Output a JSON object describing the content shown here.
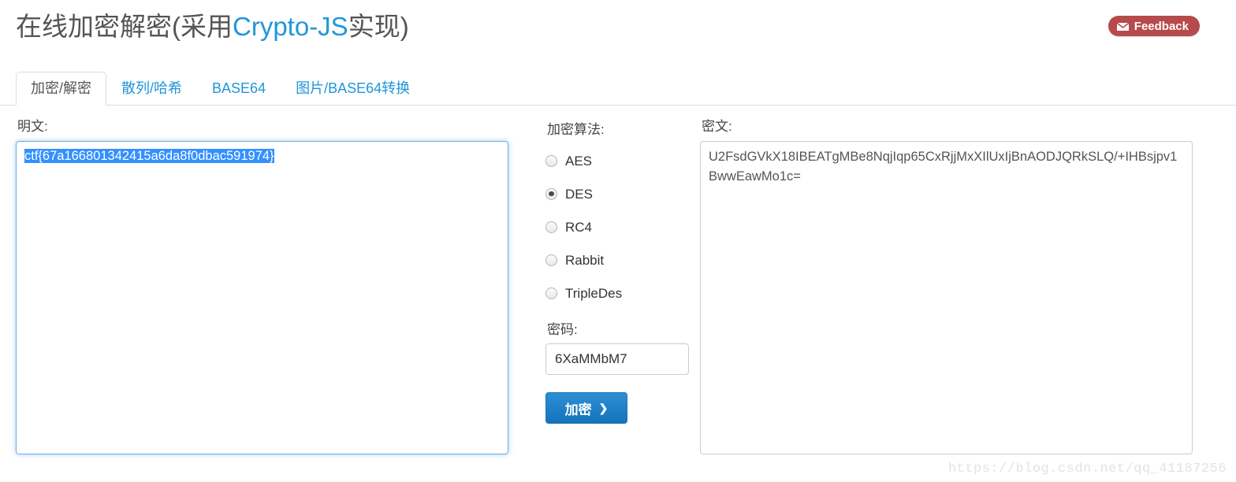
{
  "header": {
    "title_prefix": "在线加密解密(采用",
    "title_accent": "Crypto-JS",
    "title_suffix": "实现)",
    "feedback_label": "Feedback",
    "feedback_icon": "envelope-icon",
    "feedback_color": "#b74a4a",
    "accent_color": "#2196d8"
  },
  "tabs": [
    {
      "label": "加密/解密",
      "active": true
    },
    {
      "label": "散列/哈希",
      "active": false
    },
    {
      "label": "BASE64",
      "active": false
    },
    {
      "label": "图片/BASE64转换",
      "active": false
    }
  ],
  "plaintext": {
    "label": "明文:",
    "value": "ctf{67a166801342415a6da8f0dbac591974}",
    "selected": true,
    "focused": true,
    "selection_color": "#3390ff"
  },
  "options": {
    "algorithm_label": "加密算法:",
    "algorithms": [
      {
        "label": "AES",
        "checked": false
      },
      {
        "label": "DES",
        "checked": true
      },
      {
        "label": "RC4",
        "checked": false
      },
      {
        "label": "Rabbit",
        "checked": false
      },
      {
        "label": "TripleDes",
        "checked": false
      }
    ],
    "password_label": "密码:",
    "password_value": "6XaMMbM7",
    "encrypt_button_label": "加密",
    "encrypt_button_icon": "chevron-right-icon"
  },
  "ciphertext": {
    "label": "密文:",
    "value": "U2FsdGVkX18IBEATgMBe8NqjIqp65CxRjjMxXIlUxIjBnAODJQRkSLQ/+IHBsjpv1BwwEawMo1c="
  },
  "watermark": {
    "text": "https://blog.csdn.net/qq_41187256"
  }
}
